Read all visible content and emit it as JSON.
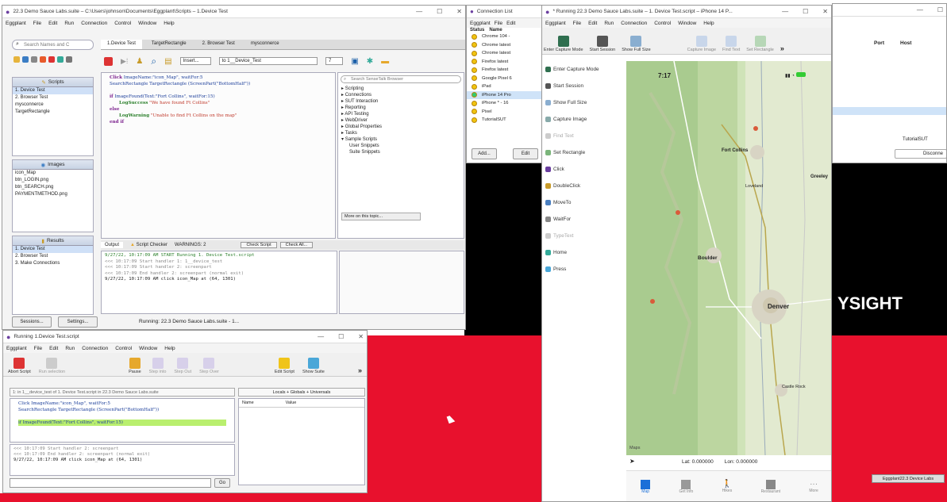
{
  "main_window": {
    "title": "22.3 Demo Sauce Labs.suite – C:\\Users\\johnson\\Documents\\Eggplant\\Scripts – 1.Device Test",
    "menu": [
      "Eggplant",
      "File",
      "Edit",
      "Run",
      "Connection",
      "Control",
      "Window",
      "Help"
    ],
    "search_placeholder": "Search Names and C",
    "tabs": [
      "1.Device Test",
      "TargetRectangle",
      "2. Browser Test",
      "mysconnerce"
    ],
    "insert_label": "Insert...",
    "handler_select": "to 1__Device_Test",
    "line_number": "7",
    "scripts_header": "Scripts",
    "scripts": [
      "1. Device Test",
      "2. Browser Test",
      "mysconnerce",
      "TargetRectangle"
    ],
    "images_header": "Images",
    "images": [
      "icon_Map",
      "btn_LOGIN.png",
      "btn_SEARCH.png",
      "PAYMENTMETHOD.png"
    ],
    "results_header": "Results",
    "results": [
      "1. Device Test",
      "2. Browser Test",
      "3. Make Connections"
    ],
    "code": [
      {
        "kw": "Click",
        "rest": "ImageName:\"icon_Map\", waitFor:5"
      },
      {
        "kw": "",
        "rest": "SearchRectangle TargetRectangle (ScreenPart(\"BottomHalf\"))"
      },
      {
        "kw": "if",
        "rest": "ImageFound(Text:\"Fort Collins\", waitFor:15)"
      },
      {
        "kw": "LogSuccess",
        "rest": "\"We have found Ft Collins\""
      },
      {
        "kw": "else",
        "rest": ""
      },
      {
        "kw": "LogWarning",
        "rest": "\"Unable to find Ft Collins on the map\""
      },
      {
        "kw": "end if",
        "rest": ""
      }
    ],
    "sensetalk_search": "Search SenseTalk Browser",
    "sensetalk_items": [
      "Scripting",
      "Connections",
      "SUT Interaction",
      "Reporting",
      "API Testing",
      "WebDriver",
      "Global Properties",
      "Tasks",
      "Sample Scripts",
      "User Snippets",
      "Suite Snippets"
    ],
    "more_on_topic": "More on this topic...",
    "output_tabs": [
      "Output",
      "Script Checker",
      "WARNINGS: 2"
    ],
    "check_script": "Check Script",
    "check_all": "Check All...",
    "log_lines": [
      "9/27/22, 10:17:09 AM   START        Running 1. Device Test.script",
      "<<< 10:17:09 Start handler 1: 1__device_test",
      "<<< 10:17:09 Start handler 2: screenpart",
      "<<< 10:17:09 End handler 2: screenpart (normal exit)",
      "9/27/22, 10:17:09 AM   click icon_Map at (64, 1301)"
    ],
    "sessions_btn": "Sessions...",
    "settings_btn": "Settings...",
    "status": "Running: 22.3 Demo Sauce Labs.suite - 1..."
  },
  "running_window": {
    "title": "Running 1.Device Test.script",
    "menu": [
      "Eggplant",
      "File",
      "Edit",
      "Run",
      "Connection",
      "Control",
      "Window",
      "Help"
    ],
    "toolbar": [
      "Abort Script",
      "Run selection",
      "Pause",
      "Step into",
      "Step Out",
      "Step Over",
      "Edit Script",
      "Show Suite"
    ],
    "handler_path": "1: in 1__device_test of 1. Device Test.script in 22.3 Demo Sauce Labs.suite",
    "vars_select": "Locals + Globals + Universals",
    "col_name": "Name",
    "col_value": "Value",
    "code": [
      "Click ImageName:\"icon_Map\", waitFor:5",
      "SearchRectangle TargetRectangle (ScreenPart(\"BottomHalf\"))",
      "if ImageFound(Text:\"Fort Collins\", waitFor:15)"
    ],
    "log_lines": [
      "<<< 10:17:09 Start handler 2: screenpart",
      "<<< 10:17:09 End handler 2: screenpart (normal exit)",
      "9/27/22, 10:17:09 AM   click icon_Map at (64, 1301)"
    ],
    "go_btn": "Go"
  },
  "connection_list": {
    "title": "Connection List",
    "menu": [
      "Eggplant",
      "File",
      "Edit"
    ],
    "col_status": "Status",
    "col_name": "Name",
    "items": [
      {
        "name": "Chrome 104 -",
        "color": "#f1c40f"
      },
      {
        "name": "Chrome latest",
        "color": "#f1c40f"
      },
      {
        "name": "Chrome latest",
        "color": "#f1c40f"
      },
      {
        "name": "Firefox latest",
        "color": "#f1c40f"
      },
      {
        "name": "Firefox latest",
        "color": "#f1c40f"
      },
      {
        "name": "Google Pixel 6",
        "color": "#f1c40f"
      },
      {
        "name": "iPad",
        "color": "#f1c40f"
      },
      {
        "name": "iPhone 14 Pro",
        "color": "#2ecc71"
      },
      {
        "name": "iPhone * - 16",
        "color": "#f1c40f"
      },
      {
        "name": "Pixel",
        "color": "#f1c40f"
      },
      {
        "name": "TutorialSUT",
        "color": "#f1c40f"
      }
    ],
    "add_btn": "Add...",
    "edit_btn": "Edit"
  },
  "iphone_window": {
    "title": "* Running 22.3 Demo Sauce Labs.suite – 1. Device Test.script – iPhone 14 P...",
    "menu": [
      "Eggplant",
      "File",
      "Edit",
      "Run",
      "Connection",
      "Control",
      "Window",
      "Help"
    ],
    "toolbar": [
      "Enter Capture Mode",
      "Start Session",
      "Show Full Size",
      "Capture Image",
      "Find Text",
      "Set Rectangle"
    ],
    "side_items": [
      "Enter Capture Mode",
      "Start Session",
      "Show Full Size",
      "Capture Image",
      "Find Text",
      "Set Rectangle",
      "Click",
      "DoubleClick",
      "MoveTo",
      "WaitFor",
      "TypeText",
      "Home",
      "Press"
    ],
    "phone_time": "7:17",
    "cities": [
      "Fort Collins",
      "Greeley",
      "Loveland",
      "Boulder",
      "Denver",
      "Castle Rock"
    ],
    "lat_label": "Lat: 0.000000",
    "lon_label": "Lon: 0.000000",
    "maps_label": "Maps",
    "tabbar": [
      "Map",
      "Get Info",
      "Hikes",
      "Restaurant",
      "More"
    ]
  },
  "right_window": {
    "col_port": "Port",
    "col_host": "Host",
    "tutorial": "TutorialSUT",
    "disconnect": "Disconne",
    "brand_partial": "YSIGHT",
    "footer_chip": "Eggplant22.3 Device Labs"
  }
}
